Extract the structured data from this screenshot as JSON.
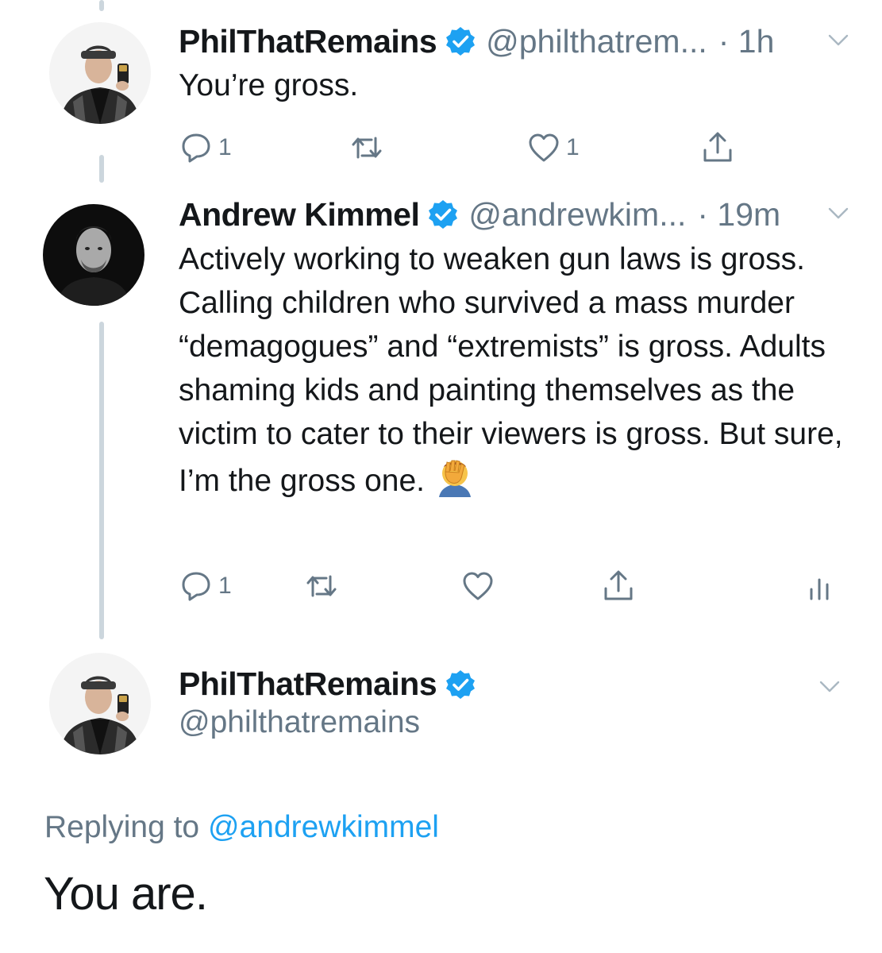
{
  "tweets": [
    {
      "display_name": "PhilThatRemains",
      "handle": "@philthatrem...",
      "time": "· 1h",
      "text": "You’re gross.",
      "reply_count": "1",
      "retweet_count": "",
      "like_count": "1"
    },
    {
      "display_name": "Andrew Kimmel",
      "handle": "@andrewkim...",
      "time": "· 19m",
      "text": "Actively working to weaken gun laws is gross. Calling children who survived a mass murder “demagogues” and “extremists” is gross. Adults shaming kids and painting themselves as the victim to cater to their viewers is gross. But sure, I’m the gross one.",
      "emoji": "facepalm",
      "reply_count": "1",
      "retweet_count": "",
      "like_count": ""
    }
  ],
  "focused_tweet": {
    "display_name": "PhilThatRemains",
    "handle": "@philthatremains",
    "replying_prefix": "Replying to",
    "replying_mention": "@andrewkimmel",
    "text": "You are."
  },
  "colors": {
    "text": "#14171a",
    "secondary": "#657786",
    "link": "#1da1f2",
    "verified": "#1da1f2",
    "thread_line": "#ccd6dd"
  },
  "icons": {
    "reply": "reply-icon",
    "retweet": "retweet-icon",
    "like": "heart-icon",
    "share": "share-icon",
    "analytics": "analytics-icon",
    "verified": "verified-badge-icon",
    "menu": "chevron-down-icon"
  }
}
